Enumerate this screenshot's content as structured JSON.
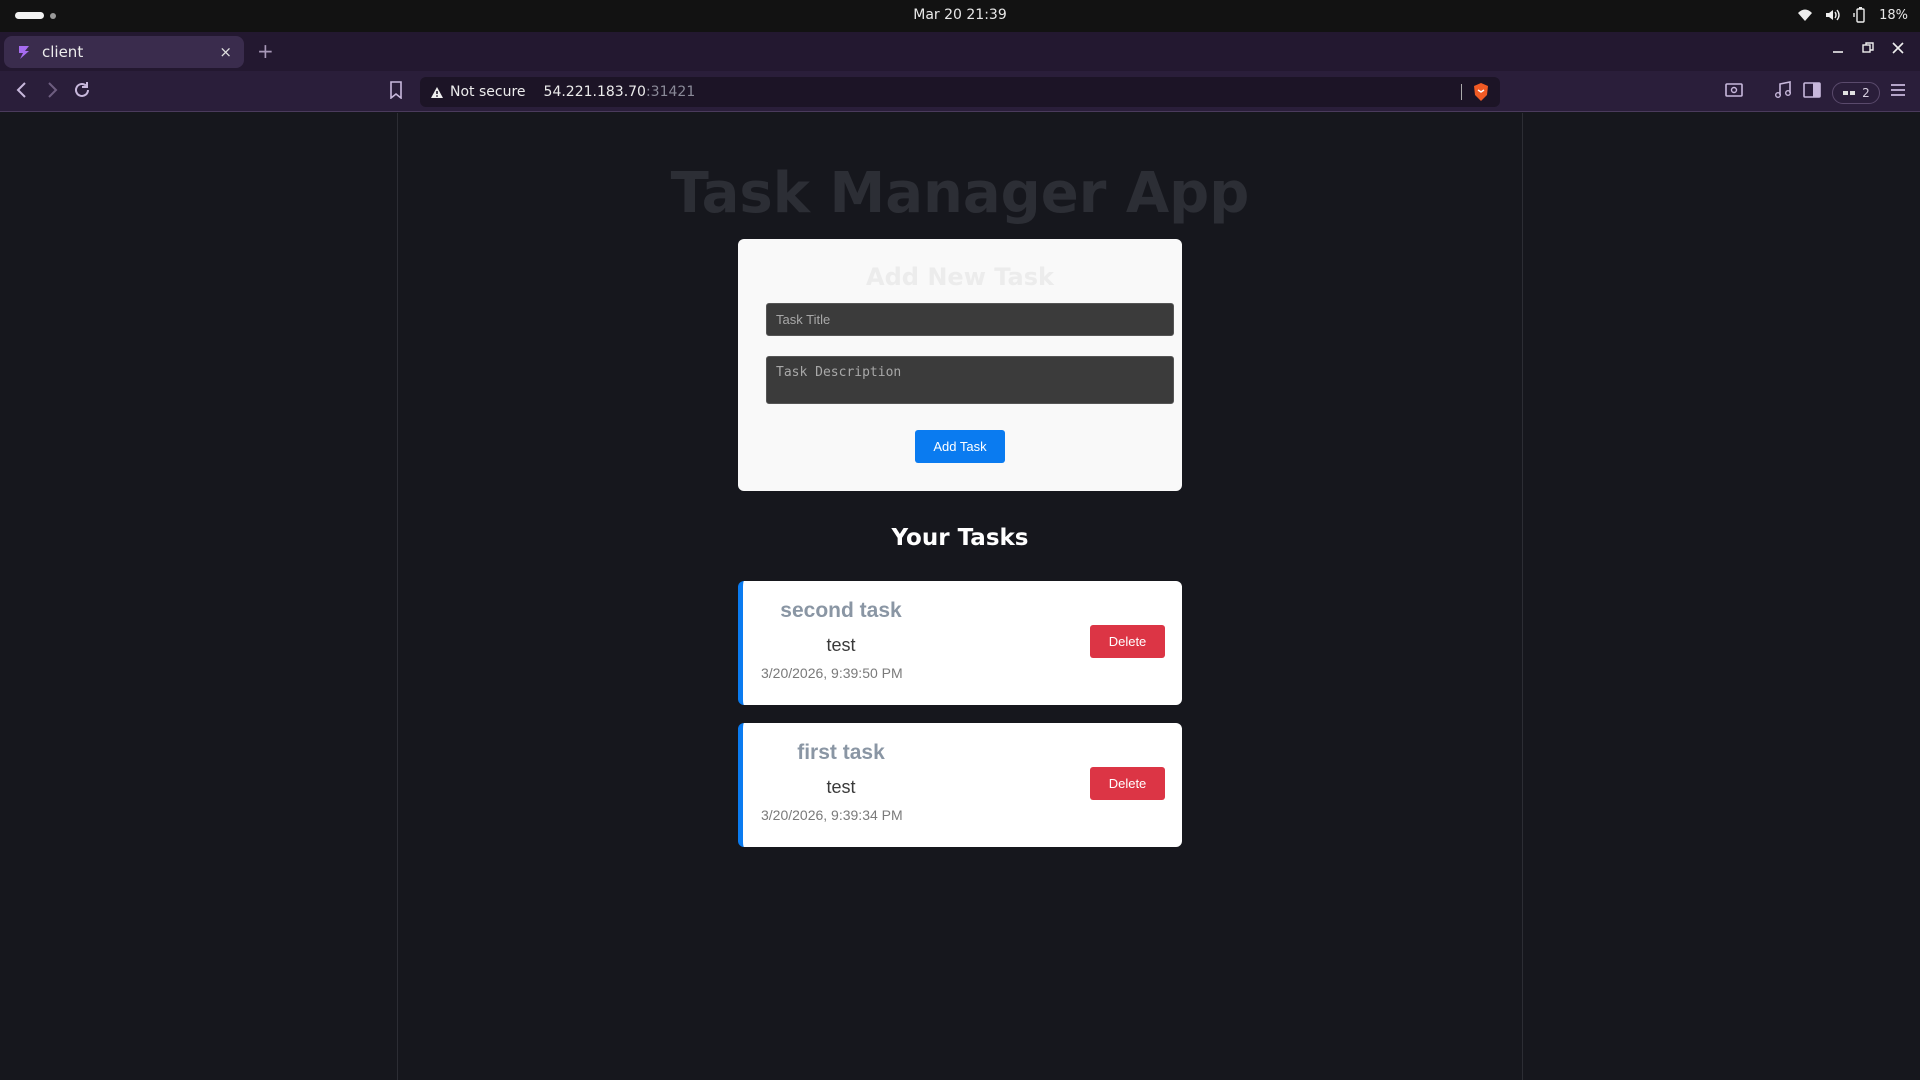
{
  "os": {
    "clock": "Mar 20  21:39",
    "battery": "18%"
  },
  "browser": {
    "tab_title": "client",
    "tab_close": "×",
    "new_tab": "+",
    "security_label": "Not secure",
    "url_host": "54.221.183.70",
    "url_port": ":31421",
    "wallet_count": "2",
    "accent": "#2a1e3a"
  },
  "app": {
    "title": "Task Manager App",
    "form": {
      "heading": "Add New Task",
      "title_placeholder": "Task Title",
      "description_placeholder": "Task Description",
      "submit_label": "Add Task"
    },
    "tasks_heading": "Your Tasks",
    "tasks": [
      {
        "title": "second task",
        "description": "test",
        "date": "3/20/2026, 9:39:50 PM",
        "delete_label": "Delete"
      },
      {
        "title": "first task",
        "description": "test",
        "date": "3/20/2026, 9:39:34 PM",
        "delete_label": "Delete"
      }
    ],
    "colors": {
      "primary": "#0a7bf0",
      "danger": "#dc3545"
    }
  }
}
